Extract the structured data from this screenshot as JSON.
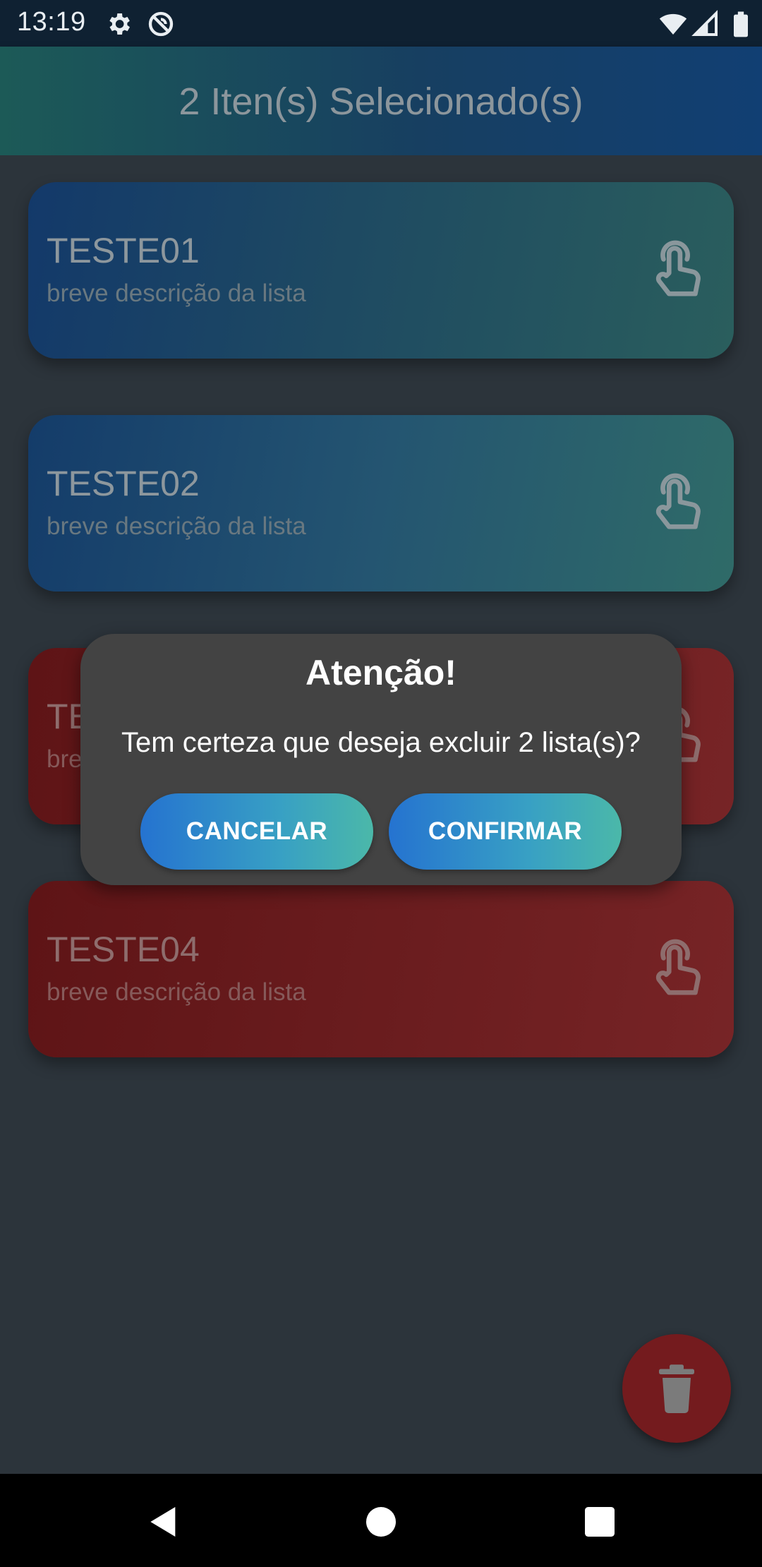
{
  "status_bar": {
    "time": "13:19",
    "icons": [
      "gear-icon",
      "do-not-disturb-icon",
      "wifi-icon",
      "signal-icon",
      "battery-icon"
    ]
  },
  "app_bar": {
    "title": "2 Iten(s) Selecionado(s)"
  },
  "cards": [
    {
      "title": "TESTE01",
      "description": "breve descrição da lista",
      "selected": false,
      "icon": "touch-icon"
    },
    {
      "title": "TESTE02",
      "description": "breve descrição da lista",
      "selected": false,
      "icon": "touch-icon"
    },
    {
      "title": "TE",
      "description": "bre",
      "selected": true,
      "icon": "touch-icon"
    },
    {
      "title": "TESTE04",
      "description": "breve descrição da lista",
      "selected": true,
      "icon": "touch-icon"
    }
  ],
  "dialog": {
    "title": "Atenção!",
    "message": "Tem certeza que deseja excluir 2 lista(s)?",
    "cancel_label": "CANCELAR",
    "confirm_label": "CONFIRMAR"
  },
  "fab": {
    "icon": "trash-icon"
  },
  "nav_bar": {
    "icons": [
      "back-icon",
      "home-icon",
      "recents-icon"
    ]
  },
  "colors": {
    "selected_card": "#6b1d1f",
    "card": "#1e4a62",
    "button_gradient_start": "#2573d0",
    "button_gradient_end": "#4bb8a9",
    "dialog_bg": "#434343"
  }
}
